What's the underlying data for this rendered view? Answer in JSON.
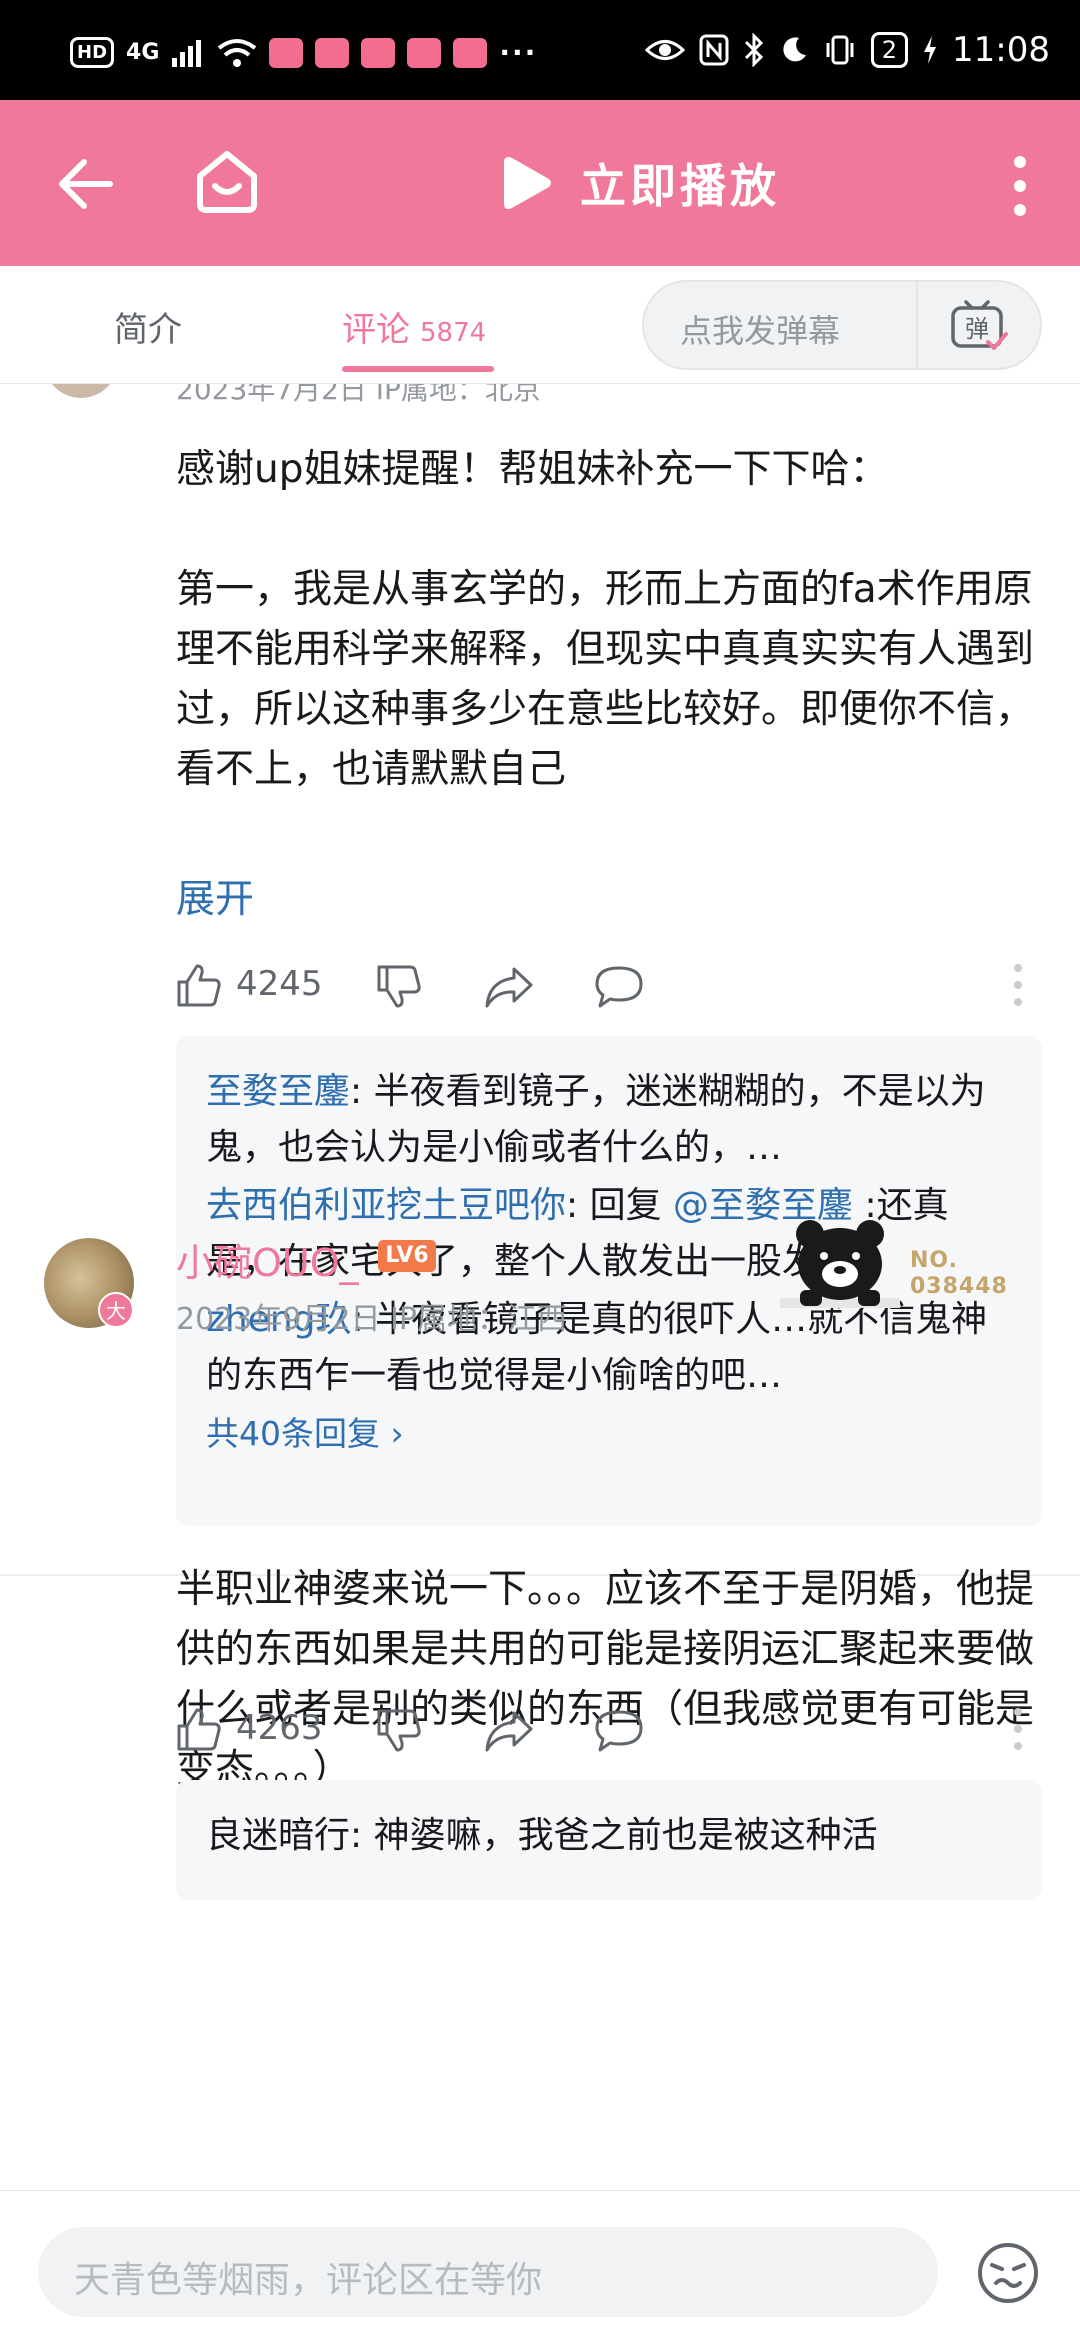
{
  "status_bar": {
    "hd": "HD",
    "network": "4G",
    "more": "···",
    "battery": "2",
    "time": "11:08"
  },
  "header": {
    "play_label": "立即播放"
  },
  "tabs": {
    "intro": "简介",
    "comments": "评论",
    "comments_count": "5874",
    "danmaku_placeholder": "点我发弹幕",
    "danmaku_toggle": "弹"
  },
  "comment1": {
    "date_cut": "2023年7月2日  IP属地：北京",
    "paragraph1": "感谢up姐妹提醒！帮姐妹补充一下下哈：",
    "paragraph2": "第一，我是从事玄学的，形而上方面的fa术作用原理不能用科学来解释，但现实中真真实实有人遇到过，所以这种事多少在意些比较好。即便你不信，看不上，也请默默自己",
    "expand": "展开",
    "likes": "4245",
    "replies": [
      {
        "user": "至婺至鏖",
        "sep": ": ",
        "mention": "",
        "text": "半夜看到镜子，迷迷糊糊的，不是以为鬼，也会认为是小偷或者什么的，…"
      },
      {
        "user": "去西伯利亚挖土豆吧你",
        "sep": ": ",
        "pre": "回复 ",
        "mention": "@至婺至鏖",
        "text": " :还真是，在家宅久了，整个人散发出一股发…"
      },
      {
        "user": "zheng玖",
        "sep": ": ",
        "mention": "",
        "text": "半夜看镜子是真的很吓人…就不信鬼神的东西乍一看也觉得是小偷啥的吧…"
      }
    ],
    "all_replies": "共40条回复 ›"
  },
  "comment2": {
    "avatar_badge": "大",
    "username": "小碗OUO_",
    "level": "LV6",
    "meta": "2023年9月2日  IP属地：江西",
    "fan_no_label": "NO.",
    "fan_no_value": "038448",
    "text": "半职业神婆来说一下。。。应该不至于是阴婚，他提供的东西如果是共用的可能是接阴运汇聚起来要做什么或者是别的类似的东西（但我感觉更有可能是变态。。。）",
    "likes": "4263",
    "reply_cut": "良迷暗行: 神婆嘛，我爸之前也是被这种活"
  },
  "bottom_bar": {
    "placeholder": "天青色等烟雨，评论区在等你"
  },
  "colors": {
    "brand_pink": "#f0789a",
    "link_blue": "#2f6fb0",
    "level_orange": "#f27a4a"
  }
}
